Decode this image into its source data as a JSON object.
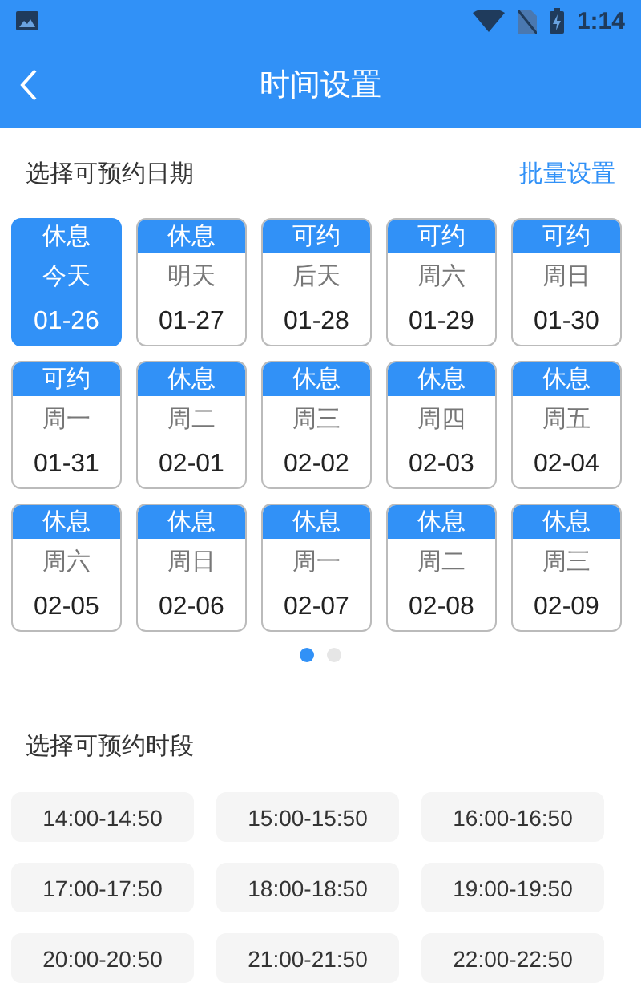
{
  "status_bar": {
    "time": "1:14"
  },
  "header": {
    "title": "时间设置"
  },
  "date_section": {
    "title": "选择可预约日期",
    "action": "批量设置",
    "dates": [
      {
        "status": "休息",
        "day": "今天",
        "date": "01-26",
        "selected": true
      },
      {
        "status": "休息",
        "day": "明天",
        "date": "01-27",
        "selected": false
      },
      {
        "status": "可约",
        "day": "后天",
        "date": "01-28",
        "selected": false
      },
      {
        "status": "可约",
        "day": "周六",
        "date": "01-29",
        "selected": false
      },
      {
        "status": "可约",
        "day": "周日",
        "date": "01-30",
        "selected": false
      },
      {
        "status": "可约",
        "day": "周一",
        "date": "01-31",
        "selected": false
      },
      {
        "status": "休息",
        "day": "周二",
        "date": "02-01",
        "selected": false
      },
      {
        "status": "休息",
        "day": "周三",
        "date": "02-02",
        "selected": false
      },
      {
        "status": "休息",
        "day": "周四",
        "date": "02-03",
        "selected": false
      },
      {
        "status": "休息",
        "day": "周五",
        "date": "02-04",
        "selected": false
      },
      {
        "status": "休息",
        "day": "周六",
        "date": "02-05",
        "selected": false
      },
      {
        "status": "休息",
        "day": "周日",
        "date": "02-06",
        "selected": false
      },
      {
        "status": "休息",
        "day": "周一",
        "date": "02-07",
        "selected": false
      },
      {
        "status": "休息",
        "day": "周二",
        "date": "02-08",
        "selected": false
      },
      {
        "status": "休息",
        "day": "周三",
        "date": "02-09",
        "selected": false
      }
    ],
    "pages": [
      {
        "selected": true
      },
      {
        "selected": false
      }
    ]
  },
  "time_section": {
    "title": "选择可预约时段",
    "slots": [
      {
        "label": "14:00-14:50",
        "selected": false
      },
      {
        "label": "15:00-15:50",
        "selected": false
      },
      {
        "label": "16:00-16:50",
        "selected": false
      },
      {
        "label": "17:00-17:50",
        "selected": false
      },
      {
        "label": "18:00-18:50",
        "selected": false
      },
      {
        "label": "19:00-19:50",
        "selected": false
      },
      {
        "label": "20:00-20:50",
        "selected": false
      },
      {
        "label": "21:00-21:50",
        "selected": false
      },
      {
        "label": "22:00-22:50",
        "selected": false
      }
    ]
  }
}
